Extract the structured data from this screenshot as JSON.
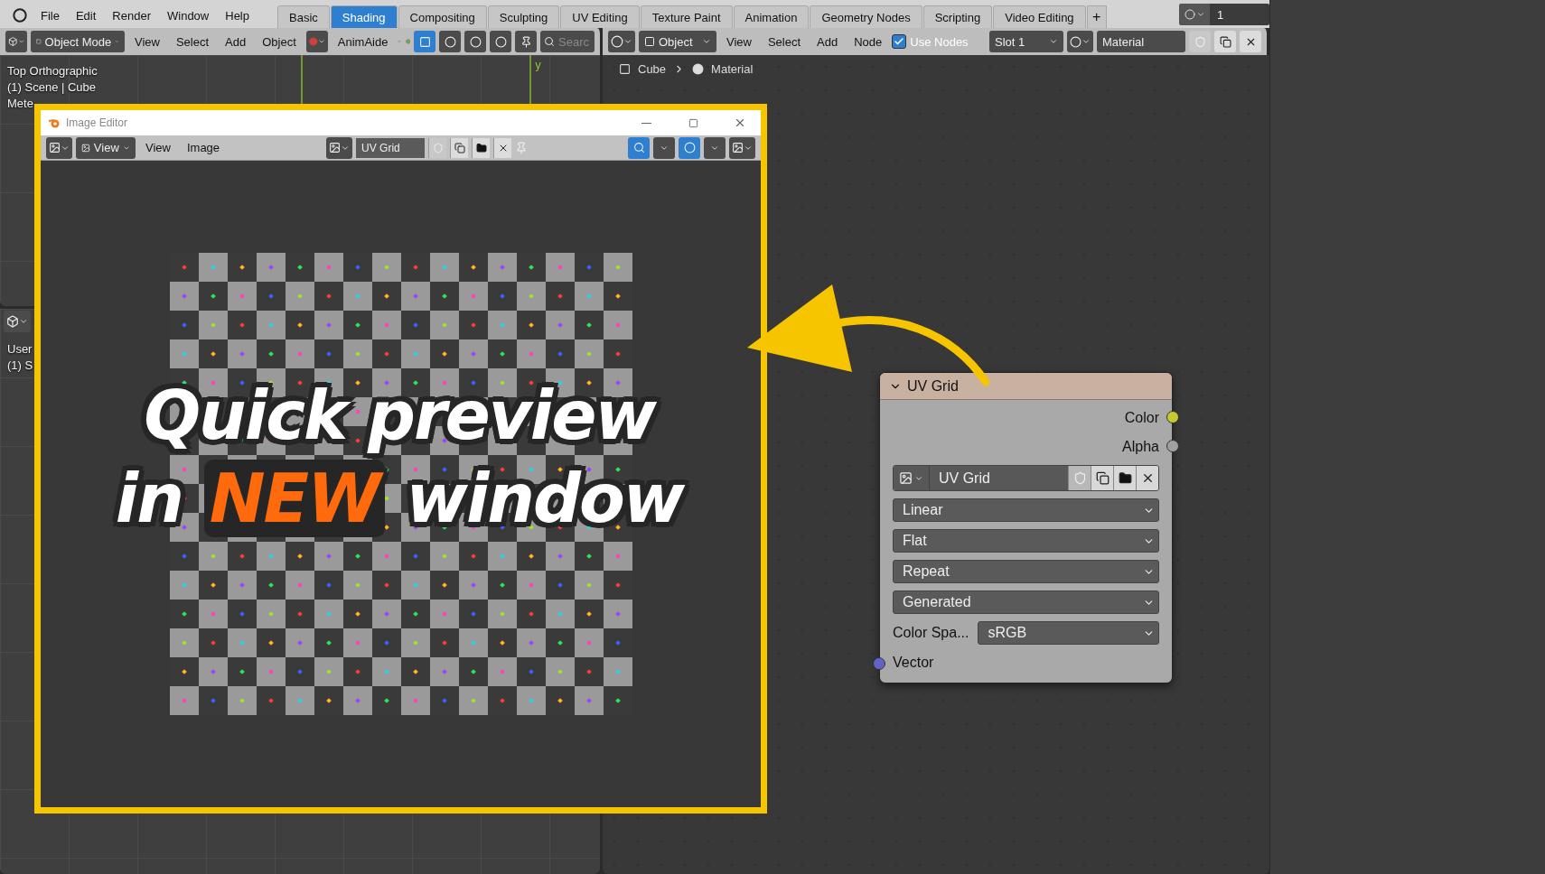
{
  "menubar": {
    "menus": [
      "File",
      "Edit",
      "Render",
      "Window",
      "Help"
    ],
    "workspace_tabs": [
      {
        "label": "Basic",
        "selected": false
      },
      {
        "label": "Shading",
        "selected": true
      },
      {
        "label": "Compositing",
        "selected": false
      },
      {
        "label": "Sculpting",
        "selected": false
      },
      {
        "label": "UV Editing",
        "selected": false
      },
      {
        "label": "Texture Paint",
        "selected": false
      },
      {
        "label": "Animation",
        "selected": false
      },
      {
        "label": "Geometry Nodes",
        "selected": false
      },
      {
        "label": "Scripting",
        "selected": false
      },
      {
        "label": "Video Editing",
        "selected": false
      }
    ],
    "add_tab": "+",
    "scene": "1"
  },
  "viewport_header": {
    "mode": "Object Mode",
    "menus": [
      "View",
      "Select",
      "Add",
      "Object"
    ],
    "addon": "AnimAide",
    "search_placeholder": "Searc"
  },
  "node_header": {
    "type": "Object",
    "menus": [
      "View",
      "Select",
      "Add",
      "Node"
    ],
    "use_nodes": {
      "label": "Use Nodes",
      "checked": true
    },
    "slot": "Slot 1",
    "material": "Material"
  },
  "viewport_top": {
    "overlay_lines": [
      "Top Orthographic",
      "(1) Scene | Cube",
      "Mete"
    ],
    "axis_label": "y"
  },
  "viewport_bottom": {
    "overlay_lines": [
      "User",
      "(1) S"
    ]
  },
  "breadcrumb": [
    "Cube",
    "Material"
  ],
  "image_editor": {
    "title": "Image Editor",
    "view_mode": "View",
    "menus": [
      "View",
      "Image"
    ],
    "image": "UV Grid"
  },
  "caption": {
    "line_1": "Quick preview",
    "line_2": [
      {
        "text": "in",
        "highlight": false
      },
      {
        "text": "NEW",
        "highlight": true
      },
      {
        "text": "window",
        "highlight": false
      }
    ]
  },
  "node": {
    "title": "UV Grid",
    "outputs": [
      {
        "name": "Color",
        "color": "#c8c832"
      },
      {
        "name": "Alpha",
        "color": "#a0a0a0"
      }
    ],
    "image": "UV Grid",
    "dropdowns": [
      "Linear",
      "Flat",
      "Repeat",
      "Generated"
    ],
    "color_space": {
      "label": "Color Spa...",
      "value": "sRGB"
    },
    "inputs": [
      {
        "name": "Vector",
        "color": "#6363c7"
      }
    ]
  }
}
